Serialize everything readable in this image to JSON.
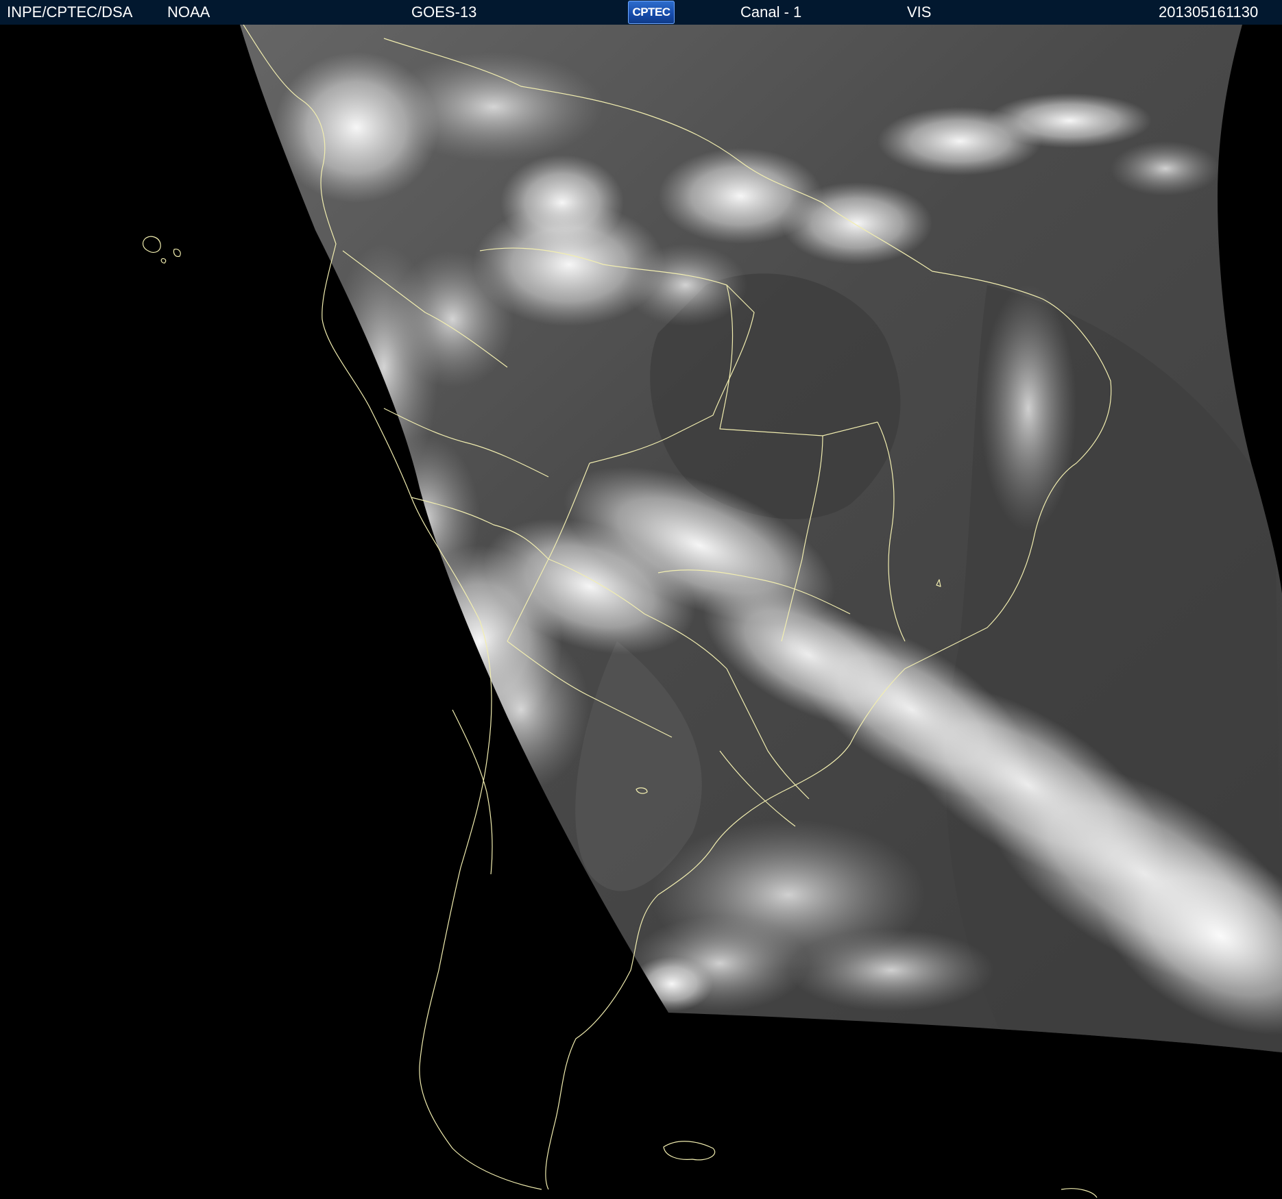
{
  "header": {
    "source_label": "INPE/CPTEC/DSA",
    "agency_label": "NOAA",
    "satellite_label": "GOES-13",
    "logo_text": "CPTEC",
    "channel_label": "Canal - 1",
    "band_label": "VIS",
    "timestamp_label": "201305161130"
  },
  "colors": {
    "header_background": "#02182f",
    "header_text": "#ffffff",
    "coastline": "#f2eeb0",
    "space_background": "#000000"
  },
  "image": {
    "description_kind": "satellite-visible-image",
    "overlay": "political-boundaries-and-coastlines"
  }
}
